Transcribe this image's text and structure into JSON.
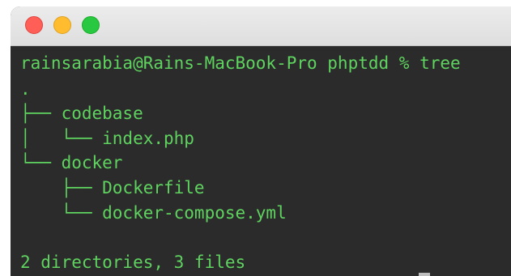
{
  "window": {
    "traffic_lights": {
      "close": "#ff5f57",
      "minimize": "#febc2e",
      "zoom": "#28c840"
    }
  },
  "terminal": {
    "text_color": "#5fd35f",
    "background": "#2b2b2b",
    "prompt": "rainsarabia@Rains-MacBook-Pro phptdd % tree",
    "lines": [
      ".",
      "├── codebase",
      "│   └── index.php",
      "└── docker",
      "    ├── Dockerfile",
      "    └── docker-compose.yml",
      "",
      "2 directories, 3 files"
    ]
  }
}
